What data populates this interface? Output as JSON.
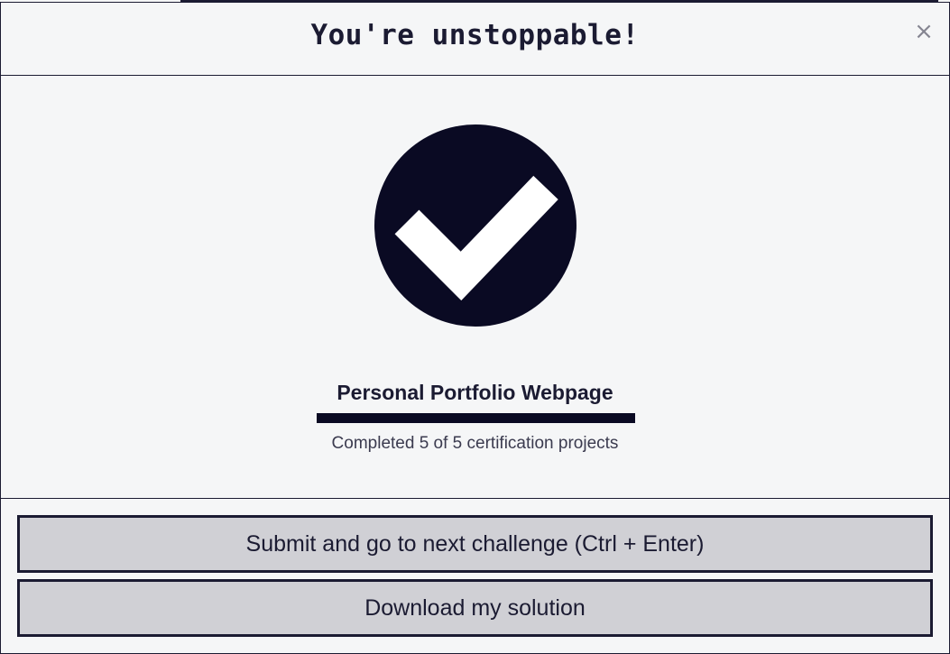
{
  "modal": {
    "title": "You're unstoppable!",
    "close_label": "×"
  },
  "completion": {
    "icon": "check-circle-icon",
    "project_title": "Personal Portfolio Webpage",
    "progress_completed": 5,
    "progress_total": 5,
    "progress_text": "Completed 5 of 5 certification projects"
  },
  "actions": {
    "submit_label": "Submit and go to next challenge (Ctrl + Enter)",
    "download_label": "Download my solution"
  },
  "colors": {
    "primary_dark": "#0a0a23",
    "button_bg": "#d0d0d5",
    "background": "#f5f6f7"
  }
}
